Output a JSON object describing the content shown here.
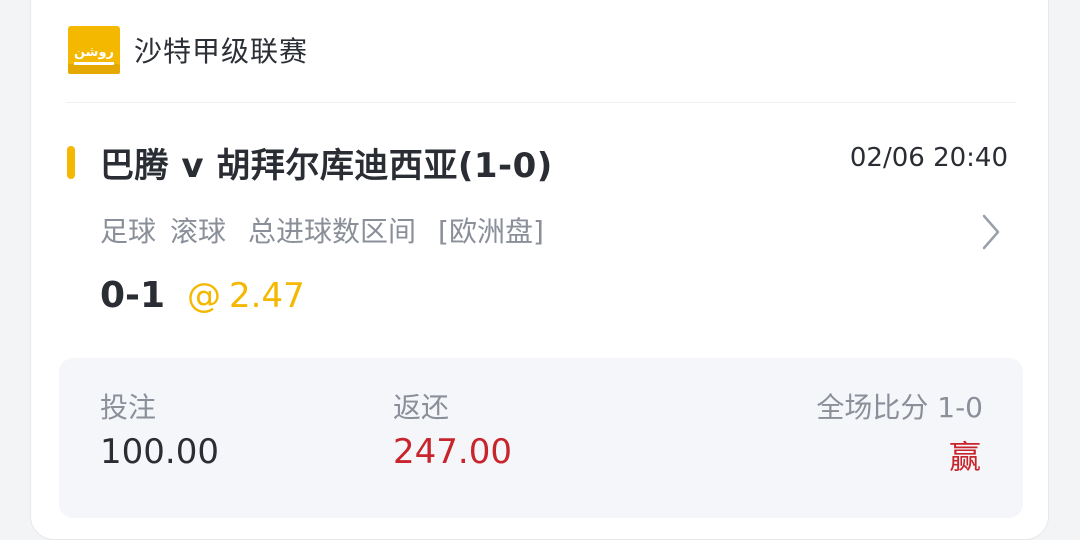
{
  "league": {
    "logo_icon": "saudi-league-logo",
    "name": "沙特甲级联赛"
  },
  "match": {
    "title": "巴腾 v 胡拜尔库迪西亚(1-0)",
    "time": "02/06 20:40"
  },
  "bet": {
    "sport": "足球",
    "mode": "滚球",
    "market": "总进球数区间",
    "odds_type": "[欧洲盘]",
    "selection": "0-1",
    "odds_prefix": "@",
    "odds": "2.47"
  },
  "summary": {
    "stake_label": "投注",
    "stake_value": "100.00",
    "return_label": "返还",
    "return_value": "247.00",
    "score_label": "全场比分 1-0",
    "result": "赢"
  },
  "colors": {
    "accent": "#f5b800",
    "win": "#c8242b",
    "text": "#2a2d33",
    "muted": "#8a8f99"
  }
}
